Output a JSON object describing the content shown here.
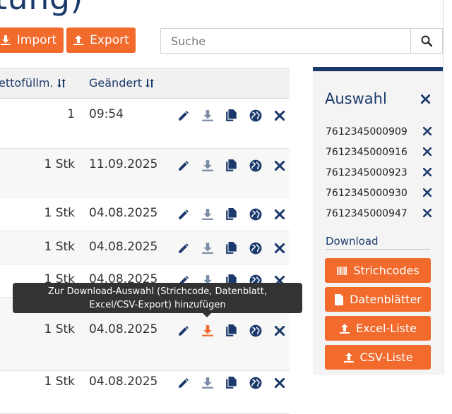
{
  "page": {
    "title_fragment": "tung)"
  },
  "toolbar": {
    "import_label": "Import",
    "export_label": "Export"
  },
  "search": {
    "placeholder": "Suche"
  },
  "table": {
    "headers": {
      "quantity": "ettofüllm.",
      "changed": "Geändert"
    },
    "rows": [
      {
        "qty": "1",
        "date": "09:54"
      },
      {
        "qty": "1 Stk",
        "date": "11.09.2025"
      },
      {
        "qty": "1 Stk",
        "date": "04.08.2025"
      },
      {
        "qty": "1 Stk",
        "date": "04.08.2025"
      },
      {
        "qty": "1 Stk",
        "date": "04.08.2025"
      },
      {
        "qty": "1 Stk",
        "date": "04.08.2025"
      },
      {
        "qty": "1 Stk",
        "date": "04.08.2025"
      }
    ]
  },
  "sidebar": {
    "title": "Auswahl",
    "items": [
      "7612345000909",
      "7612345000916",
      "7612345000923",
      "7612345000930",
      "7612345000947"
    ],
    "download_label": "Download",
    "buttons": {
      "barcodes": "Strichcodes",
      "datasheets": "Datenblätter",
      "excel": "Excel-Liste",
      "csv": "CSV-Liste"
    }
  },
  "tooltip": {
    "line1": "Zur Download-Auswahl (Strichcode, Datenblatt,",
    "line2": "Excel/CSV-Export) hinzufügen"
  },
  "colors": {
    "accent": "#f26a2c",
    "brand": "#1b3a6b",
    "icon_muted": "#7b8ca6"
  }
}
